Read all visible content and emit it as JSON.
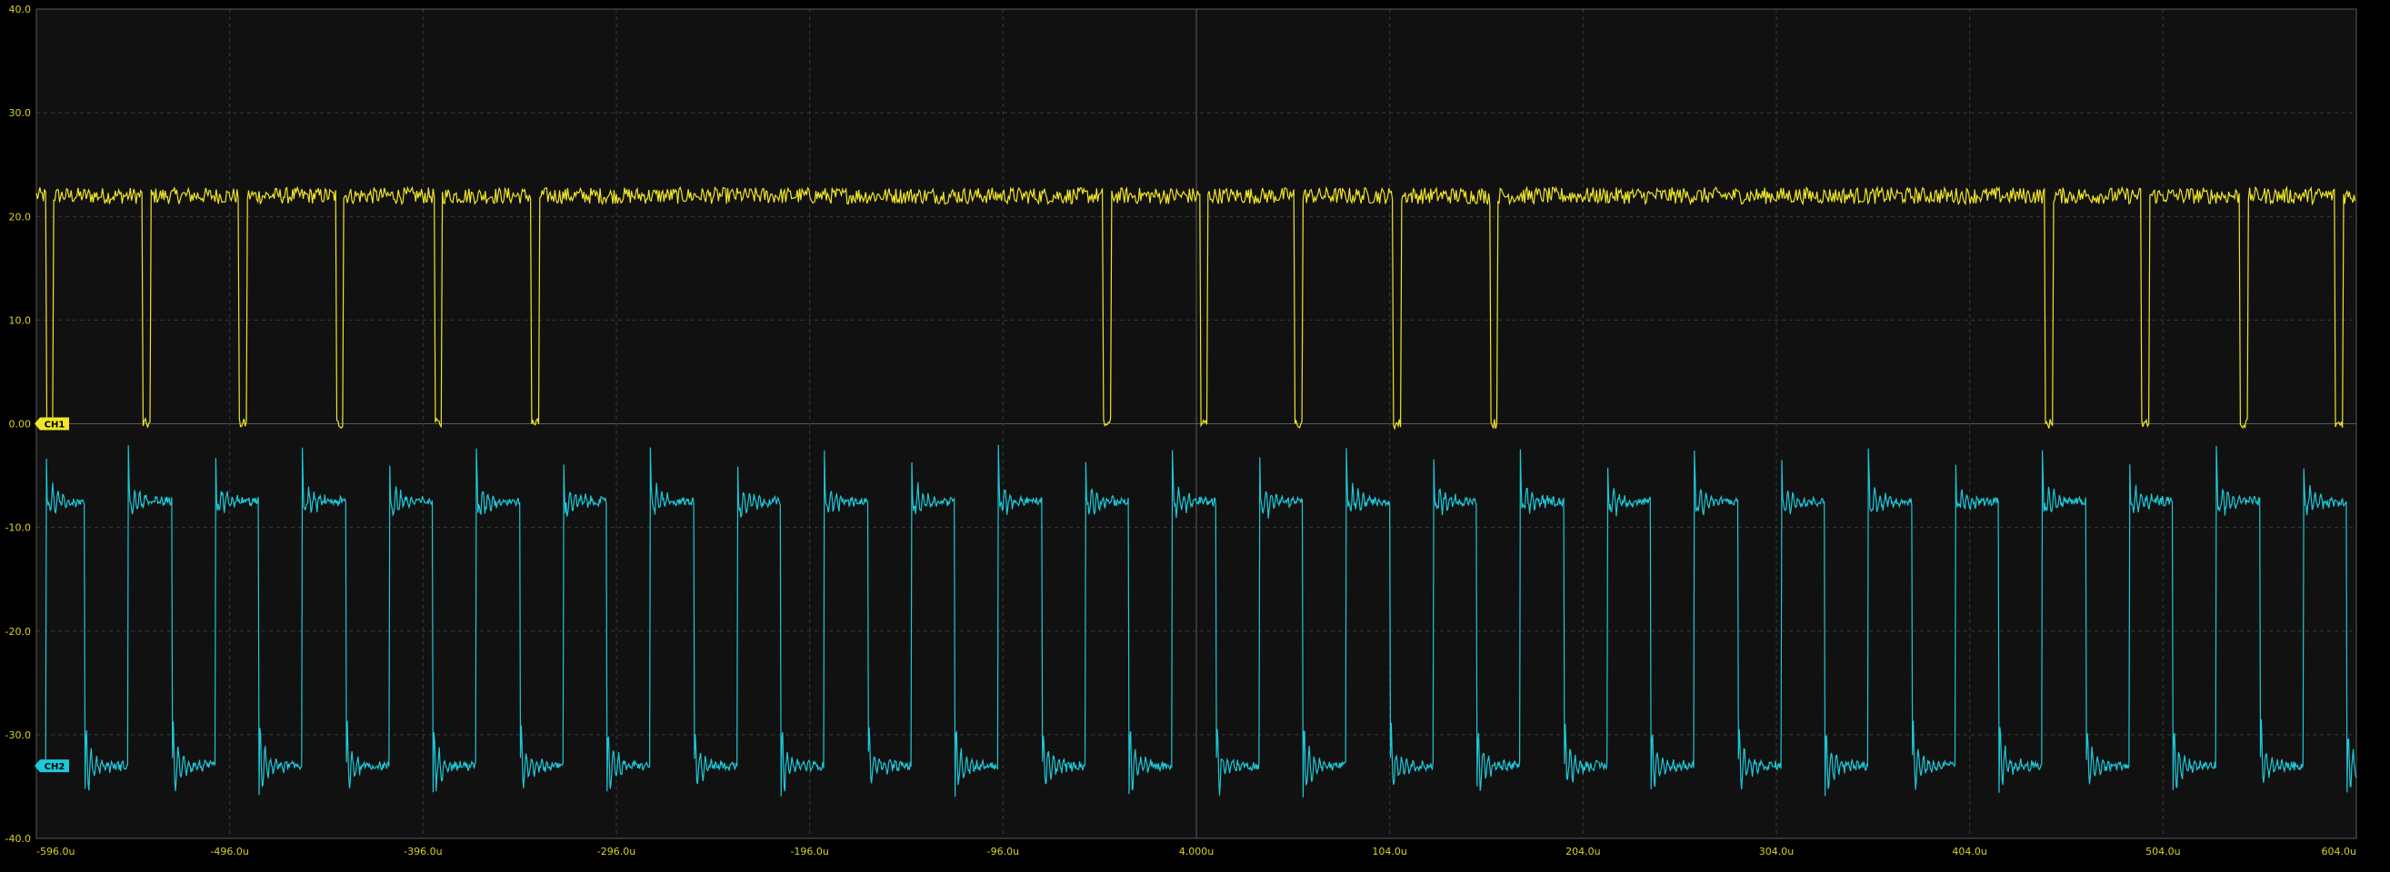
{
  "chart_data": {
    "type": "line",
    "title": "",
    "xlabel": "",
    "ylabel": "",
    "xlim": [
      -596.0,
      604.0
    ],
    "ylim": [
      -40.0,
      40.0
    ],
    "grid": true,
    "x_tick_labels": [
      "-596.0u",
      "-496.0u",
      "-396.0u",
      "-296.0u",
      "-196.0u",
      "-96.0u",
      "4.000u",
      "104.0u",
      "204.0u",
      "304.0u",
      "404.0u",
      "504.0u",
      "604.0u"
    ],
    "y_tick_labels": [
      "40.0",
      "30.0",
      "20.0",
      "10.0",
      "0.00",
      "-10.0",
      "-20.0",
      "-30.0",
      "-40.0"
    ],
    "y_ticks": [
      40,
      30,
      20,
      10,
      0,
      -10,
      -20,
      -30,
      -40
    ],
    "series": [
      {
        "name": "CH1",
        "color": "#f0e52a",
        "high": 22.0,
        "low": 0.0,
        "low_intervals_us": [
          [
            -591.0,
            -587.0
          ],
          [
            -541.0,
            -537.0
          ],
          [
            -491.0,
            -487.0
          ],
          [
            -441.0,
            -437.0
          ],
          [
            -390.0,
            -386.0
          ],
          [
            -340.0,
            -336.0
          ],
          [
            -44.0,
            -40.0
          ],
          [
            6.0,
            10.0
          ],
          [
            55.0,
            59.0
          ],
          [
            106.0,
            110.0
          ],
          [
            156.0,
            160.0
          ],
          [
            443.0,
            447.0
          ],
          [
            493.0,
            497.0
          ],
          [
            544.0,
            548.0
          ],
          [
            593.0,
            597.0
          ]
        ]
      },
      {
        "name": "CH2",
        "color": "#1ec8d8",
        "high": -7.5,
        "low": -33.0,
        "spike_high": -2.0,
        "spike_low": -38.5,
        "fall_edges_us": [
          -571.0,
          -526.0,
          -481.0,
          -436.0,
          -391.0,
          -346.0,
          -301.0,
          -256.0,
          -211.0,
          -166.0,
          -121.0,
          -76.0,
          -31.0,
          14.0,
          59.0,
          104.0,
          149.0,
          194.0,
          239.0,
          284.0,
          329.0,
          374.0,
          419.0,
          464.0,
          509.0,
          554.0,
          599.0
        ],
        "rise_edges_us": [
          -591.0,
          -548.5,
          -503.5,
          -458.5,
          -413.5,
          -368.5,
          -323.5,
          -278.5,
          -233.5,
          -188.5,
          -143.5,
          -98.5,
          -53.5,
          -8.5,
          36.5,
          81.5,
          126.5,
          171.5,
          216.5,
          261.5,
          306.5,
          351.5,
          396.5,
          441.5,
          486.5,
          531.5,
          576.5
        ]
      }
    ],
    "markers": [
      {
        "label": "CH1",
        "level": 0.0,
        "color": "#f0e52a"
      },
      {
        "label": "CH2",
        "level": -33.0,
        "color": "#1ec8d8"
      }
    ],
    "colors": {
      "background": "#000000",
      "plot_background": "#111111",
      "grid": "#3a3a3a",
      "axis": "#5a5a5a",
      "tick_label": "#d8d020"
    }
  }
}
